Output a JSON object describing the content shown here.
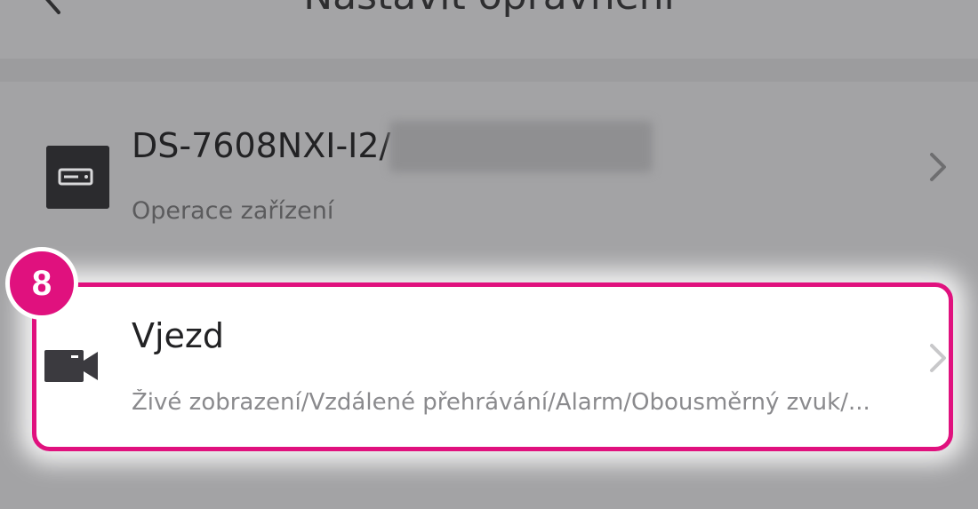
{
  "header": {
    "title": "Nastavit oprávnění",
    "back_icon": "chevron-left-icon"
  },
  "device": {
    "name": "DS-7608NXI-I2/",
    "subtitle": "Operace zařízení",
    "icon": "nvr-device-icon"
  },
  "channel": {
    "name": "Vjezd",
    "subtitle": "Živé zobrazení/Vzdálené přehrávání/Alarm/Obousměrný zvuk/...",
    "icon": "video-camera-icon"
  },
  "annotation": {
    "step": "8",
    "color": "#e0117e"
  }
}
